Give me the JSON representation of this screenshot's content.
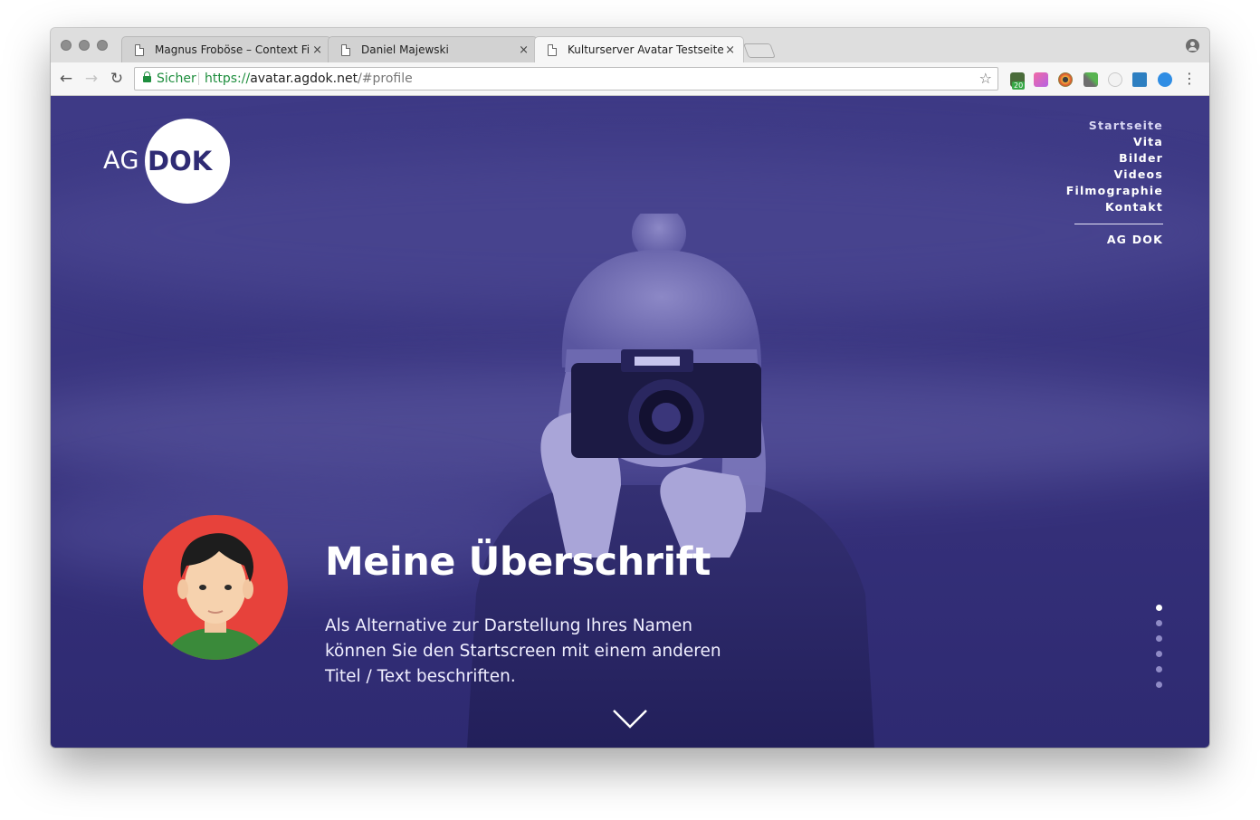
{
  "browser": {
    "tabs": [
      {
        "title": "Magnus Froböse – Context Film",
        "active": false
      },
      {
        "title": "Daniel Majewski",
        "active": false
      },
      {
        "title": "Kulturserver Avatar Testseite",
        "active": true
      }
    ],
    "close_glyph": "×",
    "nav": {
      "back": "←",
      "forward": "→",
      "reload": "↻"
    },
    "address": {
      "secure_label": "Sicher",
      "scheme": "https://",
      "host": "avatar.agdok.net",
      "path": "/#profile"
    },
    "star_glyph": "☆",
    "extension_badge": "20",
    "menu_glyph": "⋮"
  },
  "site": {
    "logo": {
      "left": "AG",
      "right": "DOK"
    },
    "nav": [
      "Startseite",
      "Vita",
      "Bilder",
      "Videos",
      "Filmographie",
      "Kontakt"
    ],
    "nav_secondary": "AG DOK",
    "hero": {
      "title": "Meine Überschrift",
      "text": "Als Alternative zur Darstellung Ihres Namen können Sie den Startscreen mit einem anderen Titel / Text beschriften."
    },
    "slides": {
      "count": 6,
      "active_index": 0
    }
  },
  "colors": {
    "overlay": "#3b3782",
    "avatar_bg": "#e7423b",
    "secure_green": "#1e8e3e"
  }
}
